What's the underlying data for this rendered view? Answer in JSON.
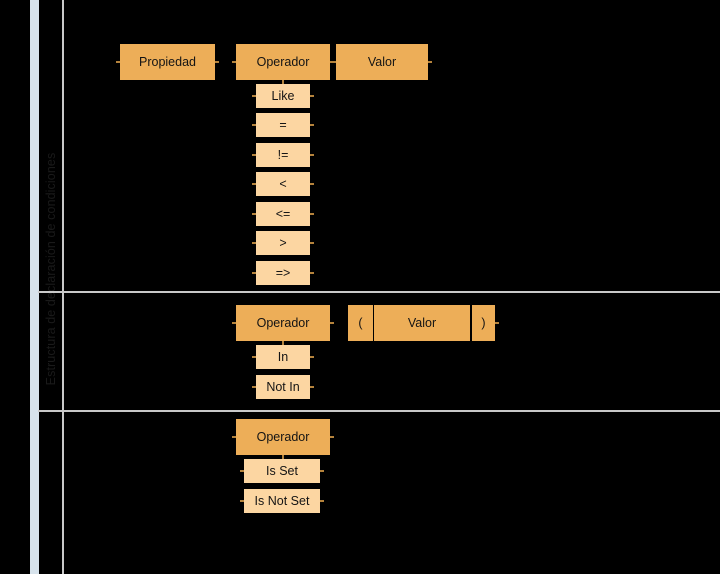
{
  "diagram": {
    "title": "Estructura de declaración de condiciones",
    "colors": {
      "background": "#000000",
      "accent_bar": "#d7e3ec",
      "node_primary": "#edae58",
      "node_secondary": "#fcd6a2",
      "rule": "#c9c9c9",
      "text": "#141414"
    }
  },
  "rows": [
    {
      "id": "row-comparison",
      "nodes": [
        {
          "label": "Propiedad",
          "kind": "primary"
        },
        {
          "label": "Operador",
          "kind": "primary"
        },
        {
          "label": "Valor",
          "kind": "primary"
        }
      ],
      "operator_options": [
        {
          "label": "Like"
        },
        {
          "label": "="
        },
        {
          "label": "!="
        },
        {
          "label": "<"
        },
        {
          "label": "<="
        },
        {
          "label": ">"
        },
        {
          "label": "=>"
        }
      ]
    },
    {
      "id": "row-membership",
      "nodes": [
        {
          "label": "Operador",
          "kind": "primary"
        },
        {
          "label": "(",
          "kind": "primary"
        },
        {
          "label": "Valor",
          "kind": "primary"
        },
        {
          "label": ")",
          "kind": "primary"
        }
      ],
      "operator_options": [
        {
          "label": "In"
        },
        {
          "label": "Not In"
        }
      ]
    },
    {
      "id": "row-existence",
      "nodes": [
        {
          "label": "Operador",
          "kind": "primary"
        }
      ],
      "operator_options": [
        {
          "label": "Is Set"
        },
        {
          "label": "Is Not Set"
        }
      ]
    }
  ]
}
